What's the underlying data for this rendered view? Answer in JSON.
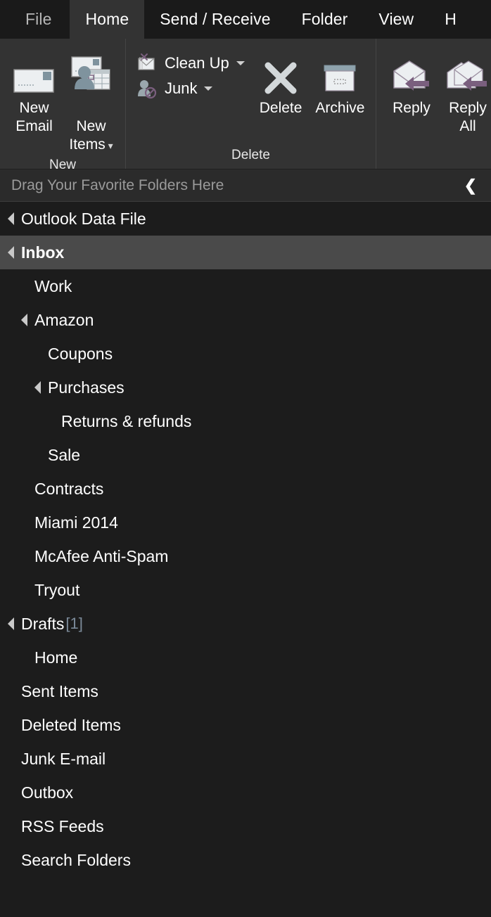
{
  "window": {
    "app": "Outlook"
  },
  "tabs": [
    {
      "label": "File",
      "active": false,
      "style": "file"
    },
    {
      "label": "Home",
      "active": true,
      "style": ""
    },
    {
      "label": "Send / Receive",
      "active": false,
      "style": ""
    },
    {
      "label": "Folder",
      "active": false,
      "style": ""
    },
    {
      "label": "View",
      "active": false,
      "style": ""
    },
    {
      "label": "H",
      "active": false,
      "style": ""
    }
  ],
  "ribbon": {
    "groups": [
      {
        "label": "New",
        "big_buttons": [
          {
            "label": "New\nEmail",
            "icon": "new-email-icon",
            "has_caret": false
          },
          {
            "label": "New\nItems",
            "icon": "new-items-icon",
            "has_caret": true
          }
        ],
        "small_buttons": []
      },
      {
        "label": "Delete",
        "big_buttons": [
          {
            "label": "Delete",
            "icon": "delete-x-icon",
            "has_caret": false
          },
          {
            "label": "Archive",
            "icon": "archive-box-icon",
            "has_caret": false
          }
        ],
        "small_buttons": [
          {
            "label": "Clean Up",
            "icon": "clean-up-icon",
            "has_caret": true
          },
          {
            "label": "Junk",
            "icon": "junk-icon",
            "has_caret": true
          }
        ]
      },
      {
        "label": "",
        "big_buttons": [
          {
            "label": "Reply",
            "icon": "reply-icon",
            "has_caret": false
          },
          {
            "label": "Reply\nAll",
            "icon": "reply-all-icon",
            "has_caret": false
          }
        ],
        "small_buttons": []
      }
    ]
  },
  "favorites_bar": {
    "text": "Drag Your Favorite Folders Here",
    "collapse_icon": "chevron-left-icon"
  },
  "folder_tree": [
    {
      "name": "Outlook Data File",
      "indent": 0,
      "expander": true,
      "selected": false,
      "count": ""
    },
    {
      "name": "Inbox",
      "indent": 0,
      "expander": true,
      "selected": true,
      "count": ""
    },
    {
      "name": "Work",
      "indent": 1,
      "expander": false,
      "selected": false,
      "count": ""
    },
    {
      "name": "Amazon",
      "indent": 1,
      "expander": true,
      "selected": false,
      "count": ""
    },
    {
      "name": "Coupons",
      "indent": 2,
      "expander": false,
      "selected": false,
      "count": ""
    },
    {
      "name": "Purchases",
      "indent": 2,
      "expander": true,
      "selected": false,
      "count": ""
    },
    {
      "name": "Returns & refunds",
      "indent": 3,
      "expander": false,
      "selected": false,
      "count": ""
    },
    {
      "name": "Sale",
      "indent": 2,
      "expander": false,
      "selected": false,
      "count": ""
    },
    {
      "name": "Contracts",
      "indent": 1,
      "expander": false,
      "selected": false,
      "count": ""
    },
    {
      "name": "Miami 2014",
      "indent": 1,
      "expander": false,
      "selected": false,
      "count": ""
    },
    {
      "name": "McAfee Anti-Spam",
      "indent": 1,
      "expander": false,
      "selected": false,
      "count": ""
    },
    {
      "name": "Tryout",
      "indent": 1,
      "expander": false,
      "selected": false,
      "count": ""
    },
    {
      "name": "Drafts",
      "indent": 0,
      "expander": true,
      "selected": false,
      "count": "[1]"
    },
    {
      "name": "Home",
      "indent": 1,
      "expander": false,
      "selected": false,
      "count": ""
    },
    {
      "name": "Sent Items",
      "indent": 0,
      "expander": false,
      "selected": false,
      "count": ""
    },
    {
      "name": "Deleted Items",
      "indent": 0,
      "expander": false,
      "selected": false,
      "count": ""
    },
    {
      "name": "Junk E-mail",
      "indent": 0,
      "expander": false,
      "selected": false,
      "count": ""
    },
    {
      "name": "Outbox",
      "indent": 0,
      "expander": false,
      "selected": false,
      "count": ""
    },
    {
      "name": "RSS Feeds",
      "indent": 0,
      "expander": false,
      "selected": false,
      "count": ""
    },
    {
      "name": "Search Folders",
      "indent": 0,
      "expander": false,
      "selected": false,
      "count": ""
    }
  ],
  "colors": {
    "background": "#1c1c1c",
    "ribbon": "#333333",
    "tabstrip": "#1a1a1a",
    "selected_row": "#4a4a4a",
    "favbar": "#2b2b2b",
    "accent_purple": "#7a5f7e",
    "icon_blue_gray": "#7f939e",
    "count_color": "#7b8a99",
    "text": "#ffffff",
    "muted_text": "#9a9a9a"
  }
}
